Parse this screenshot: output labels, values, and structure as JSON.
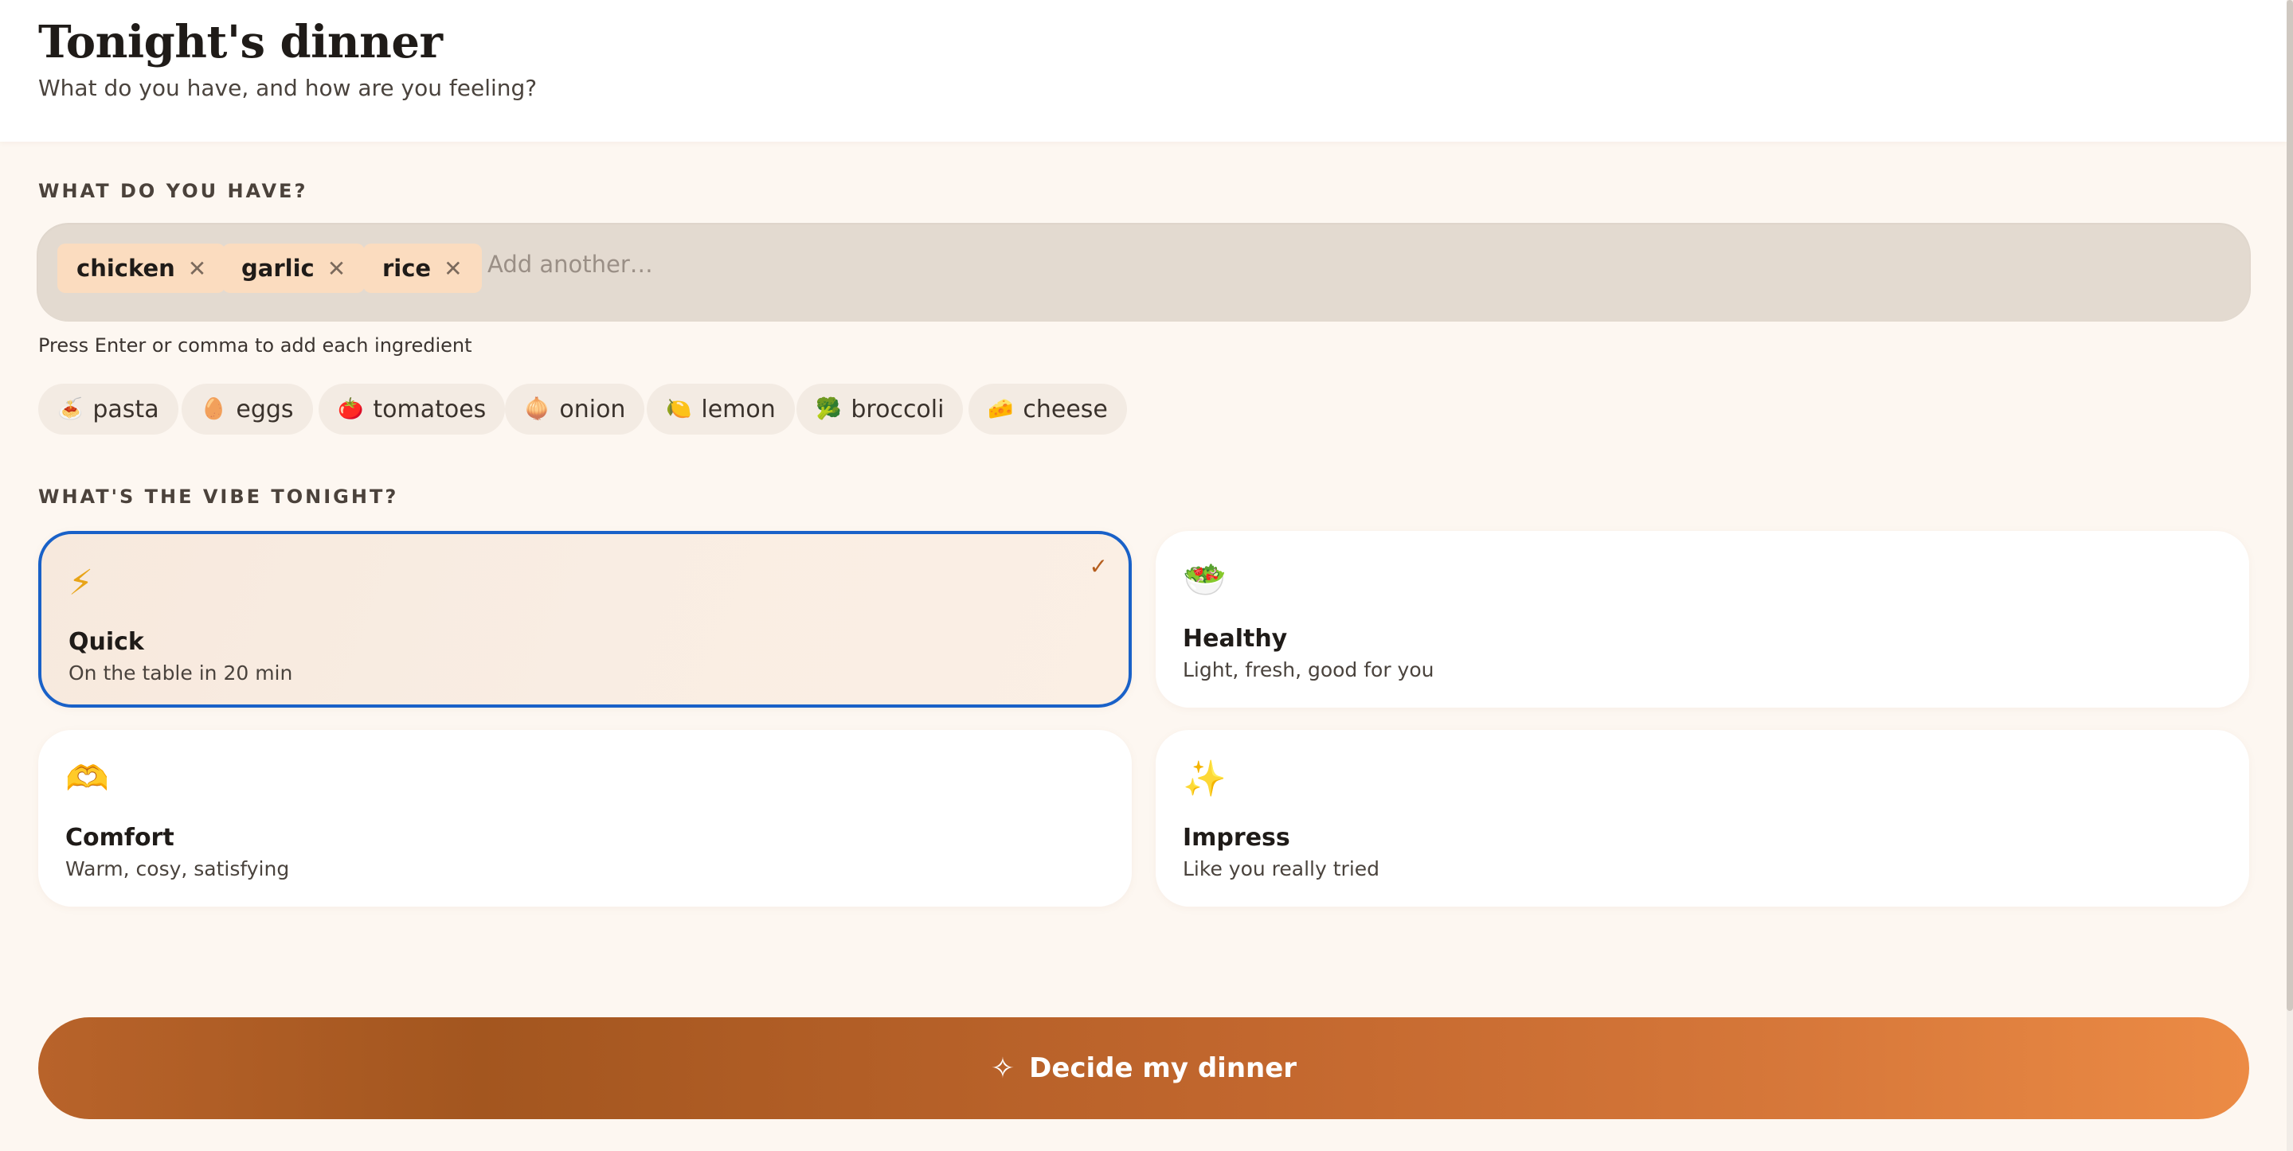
{
  "header": {
    "title": "Tonight's dinner",
    "subtitle": "What do you have, and how are you feeling?"
  },
  "ingredients": {
    "label": "WHAT DO YOU HAVE?",
    "tags": [
      {
        "label": "chicken",
        "remove_glyph": "✕"
      },
      {
        "label": "garlic",
        "remove_glyph": "✕"
      },
      {
        "label": "rice",
        "remove_glyph": "✕"
      }
    ],
    "input_value": "",
    "input_placeholder": "Add another…",
    "hint": "Press Enter or comma to add each ingredient",
    "suggestions": [
      {
        "icon": "🍝",
        "label": "pasta"
      },
      {
        "icon": "🥚",
        "label": "eggs"
      },
      {
        "icon": "🍅",
        "label": "tomatoes"
      },
      {
        "icon": "🧅",
        "label": "onion"
      },
      {
        "icon": "🍋",
        "label": "lemon"
      },
      {
        "icon": "🥦",
        "label": "broccoli"
      },
      {
        "icon": "🧀",
        "label": "cheese"
      }
    ]
  },
  "vibe": {
    "label": "WHAT'S THE VIBE TONIGHT?",
    "options": [
      {
        "icon": "⚡",
        "title": "Quick",
        "description": "On the table in 20 min",
        "selected": true,
        "check": "✓"
      },
      {
        "icon": "🥗",
        "title": "Healthy",
        "description": "Light, fresh, good for you",
        "selected": false
      },
      {
        "icon": "🫶",
        "title": "Comfort",
        "description": "Warm, cosy, satisfying",
        "selected": false
      },
      {
        "icon": "✨",
        "title": "Impress",
        "description": "Like you really tried",
        "selected": false
      }
    ]
  },
  "action": {
    "icon": "✧",
    "label": "Decide my dinner"
  },
  "colors": {
    "accent": "#1961c8",
    "button_start": "#a3561f",
    "button_end": "#ec8b45",
    "tag_bg": "#fbdcbf",
    "input_bg": "#e3dad0",
    "page_bg": "#fdf7f1"
  }
}
